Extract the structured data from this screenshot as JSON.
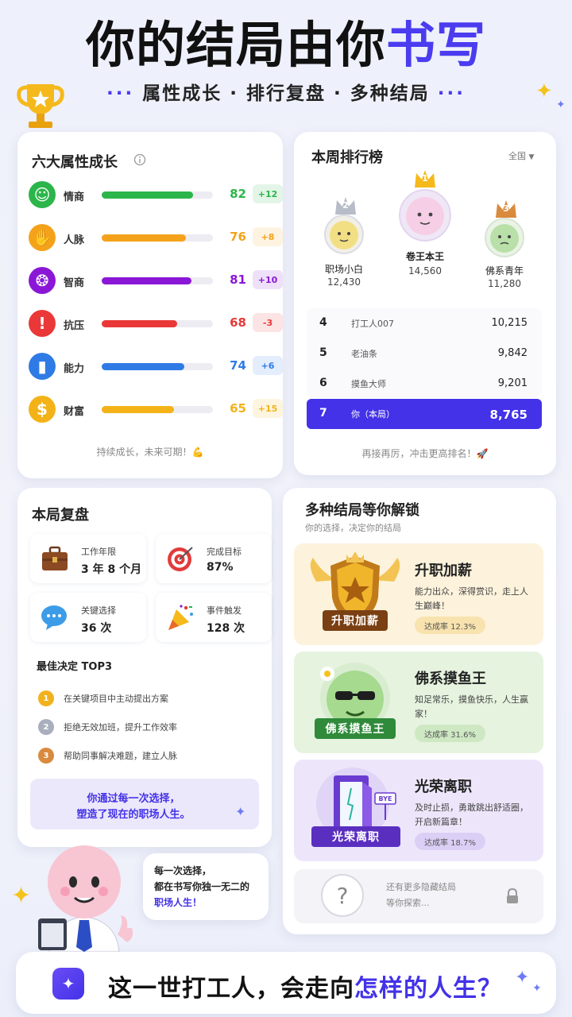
{
  "header": {
    "title_main": "你的结局由你",
    "title_accent": "书写",
    "subtitle": "属性成长 · 排行复盘 · 多种结局",
    "subtitle_dots": "···"
  },
  "attributes": {
    "title": "六大属性成长",
    "info_icon": "info-circle-icon",
    "items": [
      {
        "name": "情商",
        "value": 82,
        "delta": "+12",
        "color": "#2bb54a",
        "icon": "person-icon"
      },
      {
        "name": "人脉",
        "value": 76,
        "delta": "+8",
        "color": "#f5a21b",
        "icon": "handshake-icon"
      },
      {
        "name": "智商",
        "value": 81,
        "delta": "+10",
        "color": "#8a17d6",
        "icon": "brain-icon"
      },
      {
        "name": "抗压",
        "value": 68,
        "delta": "-3",
        "color": "#ea3838",
        "icon": "warning-icon"
      },
      {
        "name": "能力",
        "value": 74,
        "delta": "+6",
        "color": "#2f7be6",
        "icon": "bar-chart-icon"
      },
      {
        "name": "财富",
        "value": 65,
        "delta": "+15",
        "color": "#f3b318",
        "icon": "dollar-coin-icon"
      }
    ],
    "footer": "持续成长，未来可期！💪"
  },
  "ranking": {
    "title": "本周排行榜",
    "filter": "全国",
    "podium": [
      {
        "rank": "2",
        "name": "职场小白",
        "score": "12,430"
      },
      {
        "rank": "1",
        "name": "卷王本王",
        "score": "14,560"
      },
      {
        "rank": "3",
        "name": "佛系青年",
        "score": "11,280"
      }
    ],
    "rows": [
      {
        "rank": "4",
        "name": "打工人007",
        "score": "10,215"
      },
      {
        "rank": "5",
        "name": "老油条",
        "score": "9,842"
      },
      {
        "rank": "6",
        "name": "摸鱼大师",
        "score": "9,201"
      },
      {
        "rank": "7",
        "name": "你（本局）",
        "score": "8,765"
      }
    ],
    "footer": "再接再厉，冲击更高排名！🚀"
  },
  "review": {
    "title": "本局复盘",
    "stats": [
      {
        "label": "工作年限",
        "value": "3 年 8 个月",
        "icon": "briefcase-icon"
      },
      {
        "label": "完成目标",
        "value": "87%",
        "icon": "target-icon"
      },
      {
        "label": "关键选择",
        "value": "36 次",
        "icon": "chat-bubble-icon"
      },
      {
        "label": "事件触发",
        "value": "128 次",
        "icon": "party-popper-icon"
      }
    ],
    "top3_title": "最佳决定 TOP3",
    "top3": [
      {
        "medal": "1",
        "text": "在关键项目中主动提出方案"
      },
      {
        "medal": "2",
        "text": "拒绝无效加班，提升工作效率"
      },
      {
        "medal": "3",
        "text": "帮助同事解决难题，建立人脉"
      }
    ],
    "quote": [
      "你通过每一次选择，",
      "塑造了现在的职场人生。"
    ]
  },
  "endings": {
    "title": "多种结局等你解锁",
    "subtitle": "你的选择，决定你的结局",
    "items": [
      {
        "title": "升职加薪",
        "badge": "升职加薪",
        "desc": "能力出众，深得赏识，走上人生巅峰！",
        "rate": "达成率 12.3%"
      },
      {
        "title": "佛系摸鱼王",
        "badge": "佛系摸鱼王",
        "desc": "知足常乐，摸鱼快乐，人生赢家！",
        "rate": "达成率 31.6%"
      },
      {
        "title": "光荣离职",
        "badge": "光荣离职",
        "desc": "及时止损，勇敢跳出舒适圈，开启新篇章！",
        "rate": "达成率 18.7%",
        "door_sign": "BYE"
      }
    ],
    "locked_text": [
      "还有更多隐藏结局",
      "等你探索..."
    ],
    "locked_symbol": "?"
  },
  "bubble": {
    "line1": "每一次选择，",
    "line2": "都在书写你独一无二的",
    "line3": "职场人生！"
  },
  "bottom": {
    "text_main": "这一世打工人，会走向",
    "text_accent": "怎样的人生？"
  }
}
